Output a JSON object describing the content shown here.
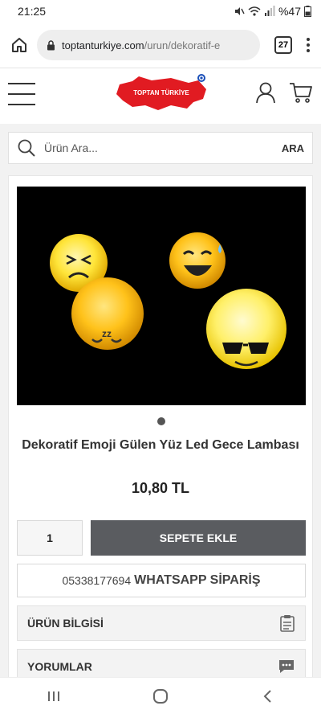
{
  "status_bar": {
    "time": "21:25",
    "battery": "%47"
  },
  "browser": {
    "url_host": "toptanturkiye.com",
    "url_path": "/urun/dekoratif-e",
    "tab_count": "27"
  },
  "header": {
    "logo_text": "TOPTAN TÜRKİYE"
  },
  "search": {
    "placeholder": "Ürün Ara...",
    "button_label": "ARA"
  },
  "product": {
    "title": "Dekoratif Emoji Gülen Yüz Led Gece Lambası",
    "price": "10,80 TL",
    "quantity": "1",
    "add_to_cart_label": "SEPETE EKLE",
    "whatsapp_phone": "05338177694",
    "whatsapp_label": "WHATSAPP SİPARİŞ"
  },
  "sections": {
    "product_info_label": "ÜRÜN BİLGİSİ",
    "reviews_label": "YORUMLAR"
  },
  "colors": {
    "primary_button": "#5a5c60",
    "logo_red": "#e11b22"
  }
}
